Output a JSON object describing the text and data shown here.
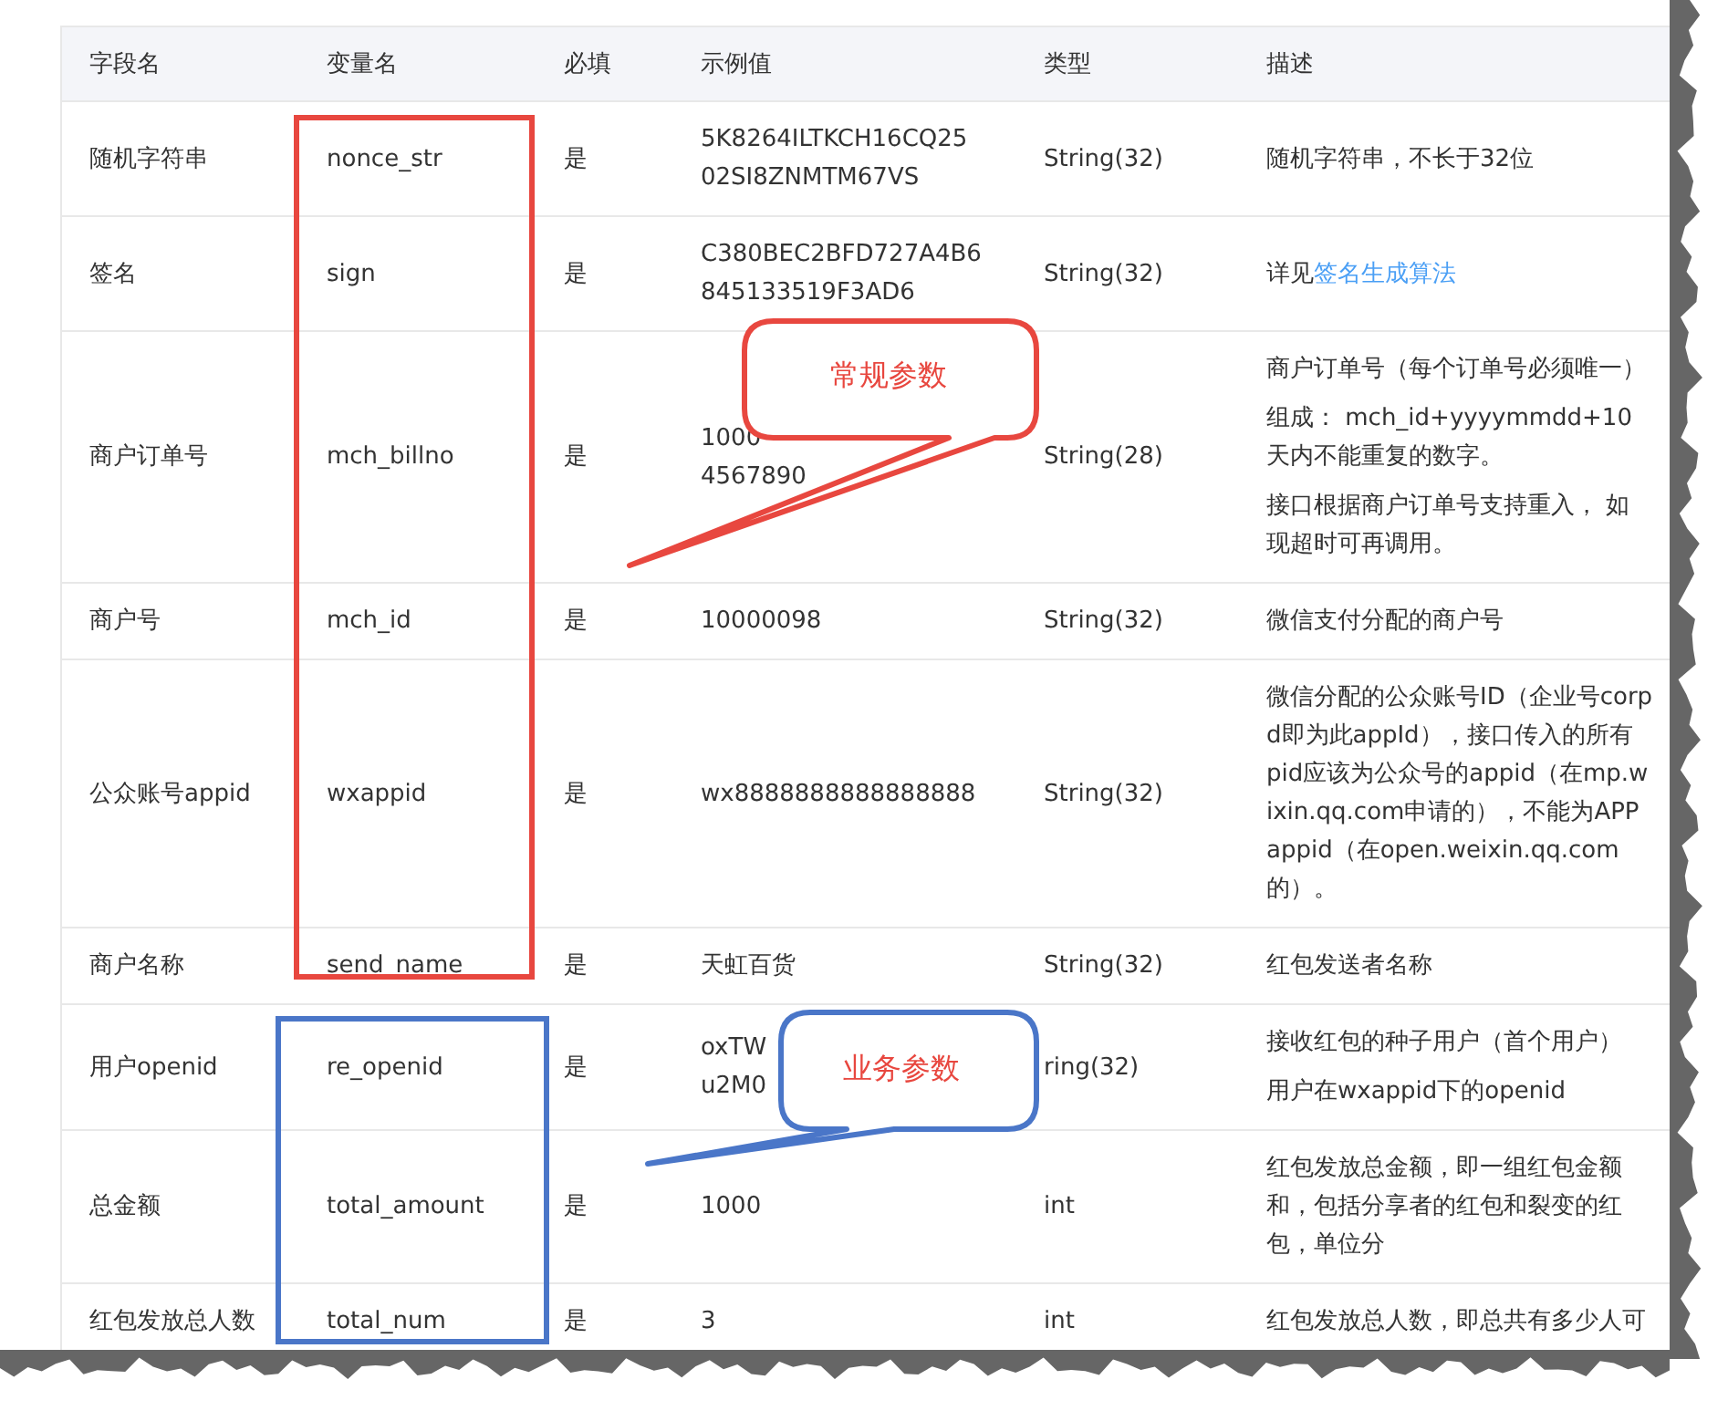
{
  "table": {
    "columns": [
      "字段名",
      "变量名",
      "必填",
      "示例值",
      "类型",
      "描述"
    ],
    "rows": [
      {
        "field": "随机字符串",
        "variable": "nonce_str",
        "required": "是",
        "example": [
          "5K8264ILTKCH16CQ25",
          "02SI8ZNMTM67VS"
        ],
        "type": "String(32)",
        "desc": [
          {
            "lines": [
              "随机字符串，不长于32位"
            ]
          }
        ]
      },
      {
        "field": "签名",
        "variable": "sign",
        "required": "是",
        "example": [
          "C380BEC2BFD727A4B6",
          "845133519F3AD6"
        ],
        "type": "String(32)",
        "desc": [
          {
            "lines": [
              "详见"
            ],
            "link": "签名生成算法"
          }
        ]
      },
      {
        "field": "商户订单号",
        "variable": "mch_billno",
        "required": "是",
        "example": [
          "1000",
          "4567890"
        ],
        "type": "String(28)",
        "desc": [
          {
            "lines": [
              "商户订单号（每个订单号必须唯一）"
            ]
          },
          {
            "lines": [
              "组成： mch_id+yyyymmdd+10",
              "天内不能重复的数字。"
            ]
          },
          {
            "lines": [
              "接口根据商户订单号支持重入， 如",
              "现超时可再调用。"
            ]
          }
        ]
      },
      {
        "field": "商户号",
        "variable": "mch_id",
        "required": "是",
        "example": [
          "10000098"
        ],
        "type": "String(32)",
        "desc": [
          {
            "lines": [
              "微信支付分配的商户号"
            ]
          }
        ]
      },
      {
        "field": "公众账号appid",
        "variable": "wxappid",
        "required": "是",
        "example": [
          "wx8888888888888888"
        ],
        "type": "String(32)",
        "desc": [
          {
            "lines": [
              "微信分配的公众账号ID（企业号corp",
              "d即为此appId），接口传入的所有",
              "pid应该为公众号的appid（在mp.w",
              "ixin.qq.com申请的），不能为APP",
              "appid（在open.weixin.qq.com",
              "的）。"
            ]
          }
        ]
      },
      {
        "field": "商户名称",
        "variable": "send_name",
        "required": "是",
        "example": [
          "天虹百货"
        ],
        "type": "String(32)",
        "desc": [
          {
            "lines": [
              "红包发送者名称"
            ]
          }
        ]
      },
      {
        "field": "用户openid",
        "variable": "re_openid",
        "required": "是",
        "example": [
          "oxTW",
          "u2M0"
        ],
        "type": "ring(32)",
        "desc": [
          {
            "lines": [
              "接收红包的种子用户（首个用户）"
            ]
          },
          {
            "lines": [
              "用户在wxappid下的openid"
            ]
          }
        ]
      },
      {
        "field": "总金额",
        "variable": "total_amount",
        "required": "是",
        "example": [
          "1000"
        ],
        "type": "int",
        "desc": [
          {
            "lines": [
              "红包发放总金额，即一组红包金额",
              "和，包括分享者的红包和裂变的红",
              "包，单位分"
            ]
          }
        ]
      },
      {
        "field": "红包发放总人数",
        "variable": "total_num",
        "required": "是",
        "example": [
          "3"
        ],
        "type": "int",
        "desc": [
          {
            "lines": [
              "红包发放总人数，即总共有多少人可"
            ]
          }
        ]
      }
    ]
  },
  "annotations": [
    {
      "label": "常规参数",
      "color": "#e8473f"
    },
    {
      "label": "业务参数",
      "color": "#4a76c8"
    }
  ]
}
